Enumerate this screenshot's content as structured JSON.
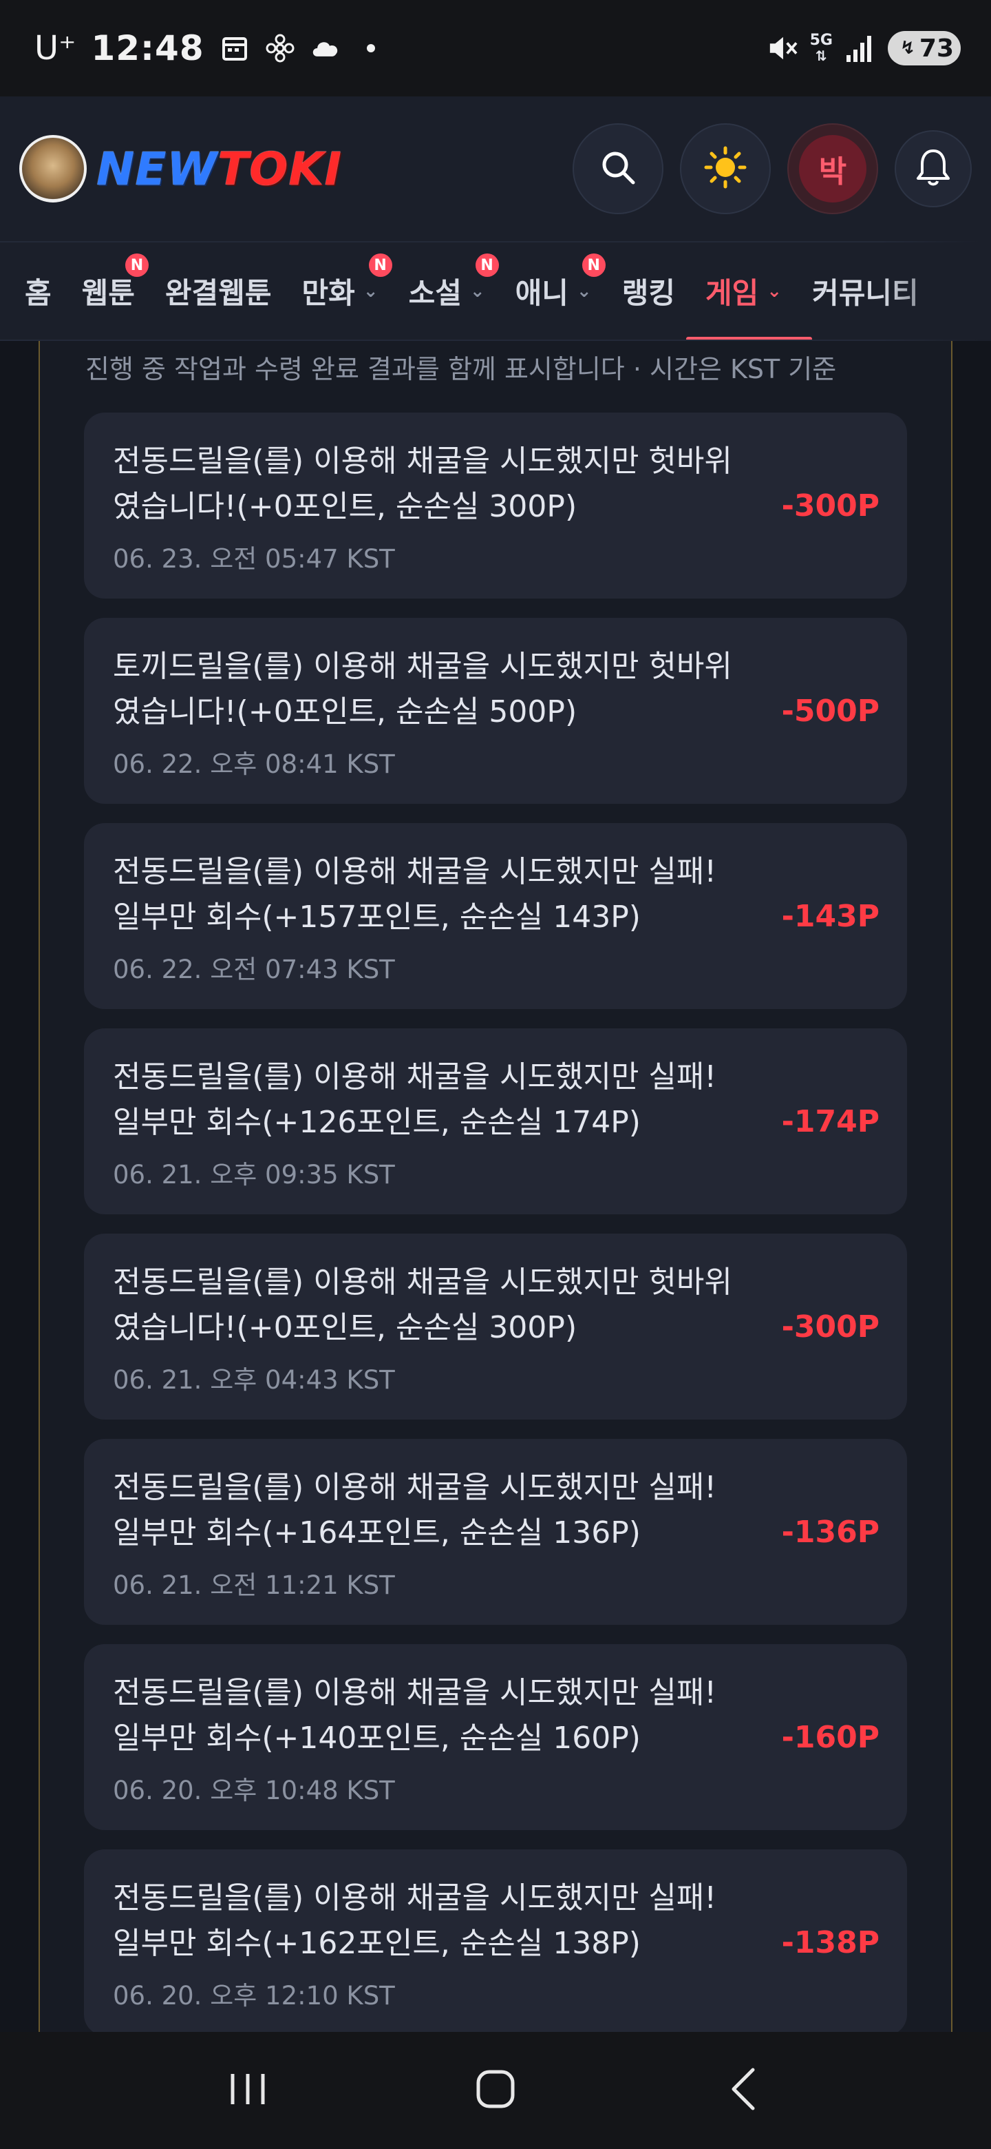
{
  "status_bar": {
    "carrier": "U⁺",
    "time": "12:48",
    "network": "5G",
    "battery": "73"
  },
  "header": {
    "logo_new": "NEW",
    "logo_toki": "TOKI",
    "avatar_initial": "박"
  },
  "nav": {
    "tabs": [
      {
        "label": "홈",
        "badge": "",
        "chevron": ""
      },
      {
        "label": "웹툰",
        "badge": "N",
        "chevron": ""
      },
      {
        "label": "완결웹툰",
        "badge": "",
        "chevron": ""
      },
      {
        "label": "만화",
        "badge": "N",
        "chevron": "⌄"
      },
      {
        "label": "소설",
        "badge": "N",
        "chevron": "⌄"
      },
      {
        "label": "애니",
        "badge": "N",
        "chevron": "⌄"
      },
      {
        "label": "랭킹",
        "badge": "",
        "chevron": ""
      },
      {
        "label": "게임",
        "badge": "",
        "chevron": "⌄"
      },
      {
        "label": "커뮤니티",
        "badge": "",
        "chevron": ""
      }
    ],
    "active_tab": "게임"
  },
  "content": {
    "subnote": "진행 중 작업과 수령 완료 결과를 함께 표시합니다 · 시간은 KST 기준",
    "items": [
      {
        "line1": "전동드릴을(를) 이용해 채굴을 시도했지만 헛바위",
        "line2": "였습니다!(+0포인트, 순손실 300P)",
        "time": "06. 23. 오전 05:47 KST",
        "amount": "-300P"
      },
      {
        "line1": "토끼드릴을(를) 이용해 채굴을 시도했지만 헛바위",
        "line2": "였습니다!(+0포인트, 순손실 500P)",
        "time": "06. 22. 오후 08:41 KST",
        "amount": "-500P"
      },
      {
        "line1": "전동드릴을(를) 이용해 채굴을 시도했지만 실패!",
        "line2": "일부만 회수(+157포인트, 순손실 143P)",
        "time": "06. 22. 오전 07:43 KST",
        "amount": "-143P"
      },
      {
        "line1": "전동드릴을(를) 이용해 채굴을 시도했지만 실패!",
        "line2": "일부만 회수(+126포인트, 순손실 174P)",
        "time": "06. 21. 오후 09:35 KST",
        "amount": "-174P"
      },
      {
        "line1": "전동드릴을(를) 이용해 채굴을 시도했지만 헛바위",
        "line2": "였습니다!(+0포인트, 순손실 300P)",
        "time": "06. 21. 오후 04:43 KST",
        "amount": "-300P"
      },
      {
        "line1": "전동드릴을(를) 이용해 채굴을 시도했지만 실패!",
        "line2": "일부만 회수(+164포인트, 순손실 136P)",
        "time": "06. 21. 오전 11:21 KST",
        "amount": "-136P"
      },
      {
        "line1": "전동드릴을(를) 이용해 채굴을 시도했지만 실패!",
        "line2": "일부만 회수(+140포인트, 순손실 160P)",
        "time": "06. 20. 오후 10:48 KST",
        "amount": "-160P"
      },
      {
        "line1": "전동드릴을(를) 이용해 채굴을 시도했지만 실패!",
        "line2": "일부만 회수(+162포인트, 순손실 138P)",
        "time": "06. 20. 오후 12:10 KST",
        "amount": "-138P"
      }
    ]
  },
  "colors": {
    "accent": "#ff5c6c",
    "loss": "#ff3b45",
    "background": "#12151c",
    "card": "#232734"
  },
  "icons": [
    "calendar-icon",
    "fan-icon",
    "cloud-icon",
    "mute-icon",
    "signal-icon",
    "search-icon",
    "sun-icon",
    "bell-icon",
    "recent-apps-icon",
    "home-icon",
    "back-icon"
  ]
}
